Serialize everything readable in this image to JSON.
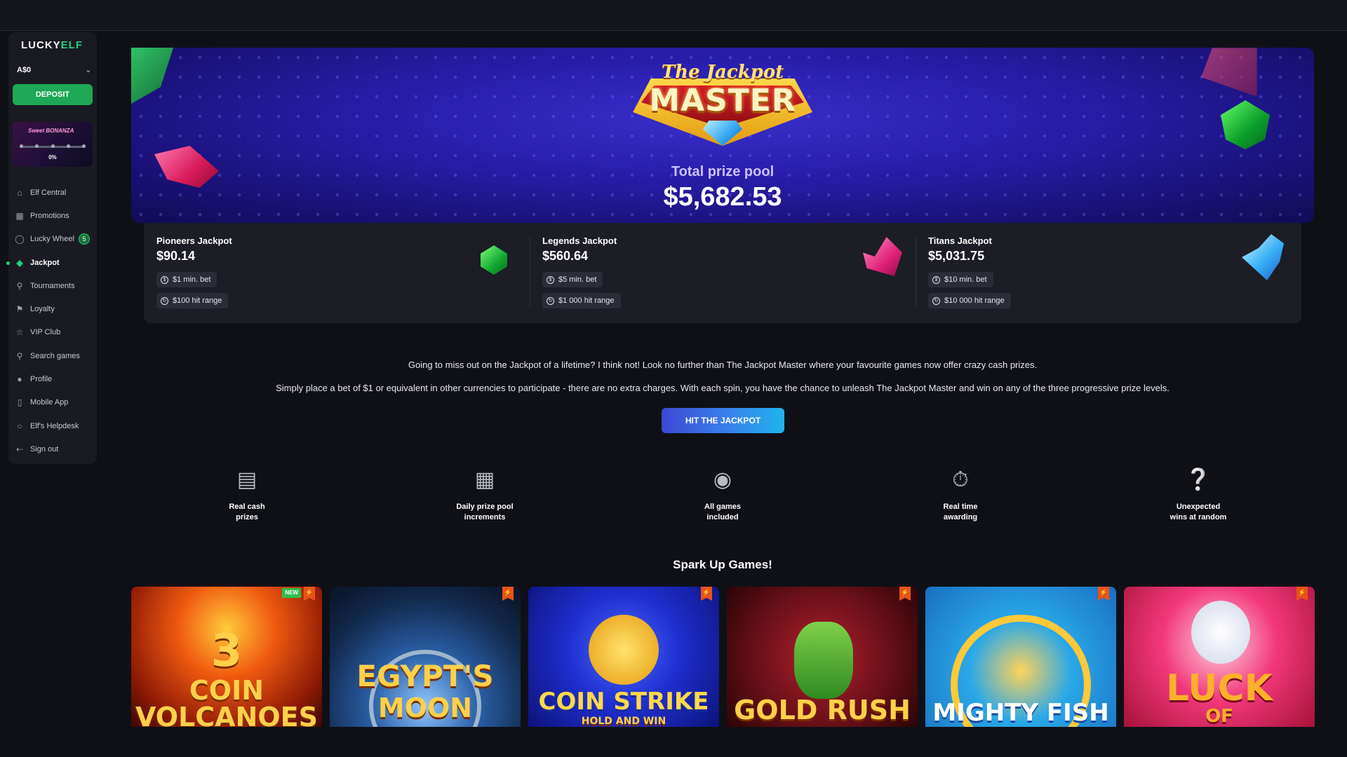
{
  "sidebar": {
    "logo": {
      "part1": "LUCKY",
      "part2": "ELF"
    },
    "balance": "A$0",
    "deposit_label": "DEPOSIT",
    "promo": {
      "title": "Sweet BONANZA",
      "progress_text": "0%",
      "progress": 0
    },
    "items": [
      {
        "label": "Elf Central",
        "icon": "home-icon"
      },
      {
        "label": "Promotions",
        "icon": "gift-icon"
      },
      {
        "label": "Lucky Wheel",
        "icon": "wheel-icon",
        "badge": "5"
      },
      {
        "label": "Jackpot",
        "icon": "diamond-icon",
        "active": true
      },
      {
        "label": "Tournaments",
        "icon": "trophy-icon"
      },
      {
        "label": "Loyalty",
        "icon": "flag-icon"
      },
      {
        "label": "VIP Club",
        "icon": "star-icon"
      },
      {
        "label": "Search games",
        "icon": "search-icon"
      },
      {
        "label": "Profile",
        "icon": "user-icon"
      },
      {
        "label": "Mobile App",
        "icon": "mobile-icon"
      },
      {
        "label": "Elf's Helpdesk",
        "icon": "chat-icon"
      },
      {
        "label": "Sign out",
        "icon": "sign-out-icon"
      }
    ]
  },
  "banner": {
    "logo_script": "The Jackpot",
    "logo_word": "MASTER",
    "prize_label": "Total prize pool",
    "prize_value": "$5,682.53"
  },
  "tiers": [
    {
      "name": "Pioneers Jackpot",
      "value": "$90.14",
      "min_bet": "$1 min. bet",
      "hit_range": "$100 hit range",
      "gem": "green-gem-icon"
    },
    {
      "name": "Legends Jackpot",
      "value": "$560.64",
      "min_bet": "$5 min. bet",
      "hit_range": "$1 000 hit range",
      "gem": "pink-gem-icon"
    },
    {
      "name": "Titans Jackpot",
      "value": "$5,031.75",
      "min_bet": "$10 min. bet",
      "hit_range": "$10 000 hit range",
      "gem": "blue-gem-icon"
    }
  ],
  "description": {
    "line1": "Going to miss out on the Jackpot of a lifetime? I think not! Look no further than The Jackpot Master where your favourite games now offer crazy cash prizes.",
    "line2": "Simply place a bet of $1 or equivalent in other currencies to participate - there are no extra charges. With each spin, you have the chance to unleash The Jackpot Master and win on any of the three progressive prize levels."
  },
  "cta_label": "HIT THE JACKPOT",
  "features": [
    {
      "label": "Real cash\nprizes",
      "icon": "cash-icon"
    },
    {
      "label": "Daily prize pool\nincrements",
      "icon": "gift-box-icon"
    },
    {
      "label": "All games\nincluded",
      "icon": "gamepad-icon"
    },
    {
      "label": "Real time\nawarding",
      "icon": "stopwatch-icon"
    },
    {
      "label": "Unexpected\nwins at random",
      "icon": "mystery-box-icon"
    }
  ],
  "games_title": "Spark Up Games!",
  "games": [
    {
      "line1": "3",
      "line2": "COIN",
      "line3": "VOLCANOES",
      "new": "NEW"
    },
    {
      "line1": "EGYPT'S",
      "line2": "MOON"
    },
    {
      "line1": "COIN STRIKE",
      "line2": "HOLD AND WIN"
    },
    {
      "line1": "GOLD RUSH"
    },
    {
      "line1": "MIGHTY FISH"
    },
    {
      "line1": "LUCK",
      "line2": "OF"
    }
  ],
  "colors": {
    "accent_green": "#22d37a",
    "deposit_green": "#1fa855",
    "cta_blue": "#3a7de8",
    "background": "#0f1016"
  }
}
